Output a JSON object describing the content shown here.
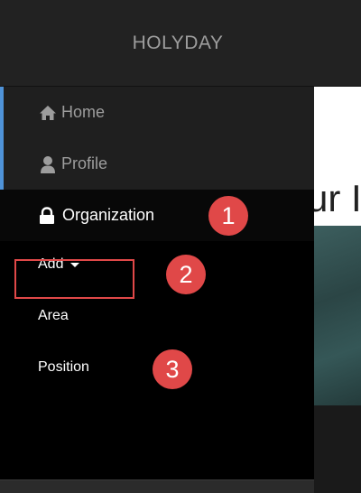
{
  "navbar": {
    "brand": "HOLYDAY"
  },
  "sidebar": {
    "items": [
      {
        "label": "Home",
        "icon": "home-icon"
      },
      {
        "label": "Profile",
        "icon": "user-icon"
      },
      {
        "label": "Organization",
        "icon": "lock-icon"
      }
    ],
    "submenu": {
      "add_label": "Add",
      "items": [
        {
          "label": "Area"
        },
        {
          "label": "Position"
        }
      ]
    }
  },
  "content": {
    "heading_fragment": "ur I"
  },
  "annotations": {
    "steps": [
      "1",
      "2",
      "3"
    ],
    "color": "#e04848"
  },
  "colors": {
    "accent": "#4f93d8",
    "navbar_bg": "#222222",
    "submenu_bg": "#000000"
  }
}
